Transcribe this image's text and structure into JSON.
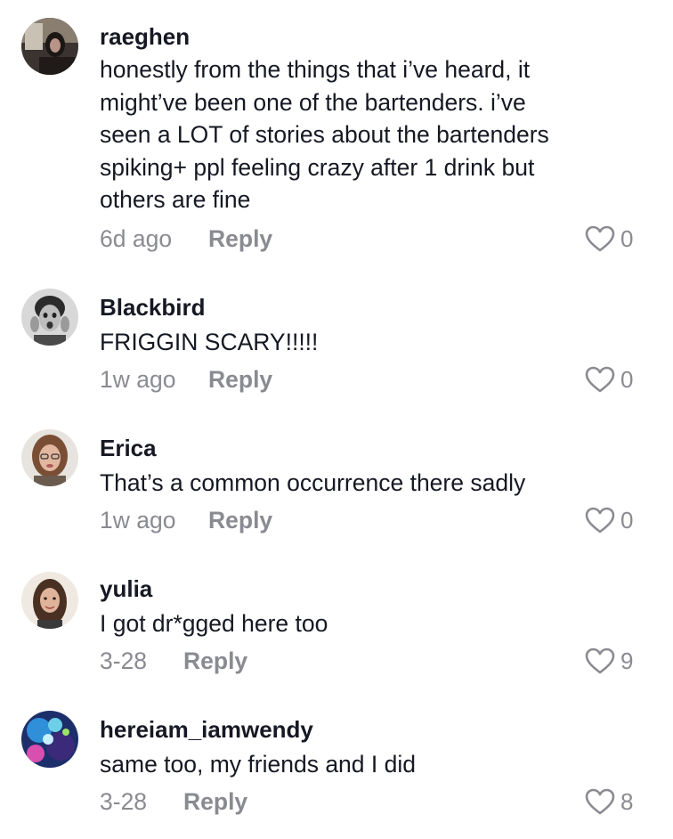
{
  "comments": [
    {
      "username": "raeghen",
      "lines": [
        "honestly from the things that i’ve heard, it",
        "might’ve been one of the bartenders. i’ve",
        "seen a LOT of stories about the bartenders",
        "spiking+ ppl feeling crazy after 1 drink but",
        "others are fine"
      ],
      "time": "6d ago",
      "reply_label": "Reply",
      "likes": "0"
    },
    {
      "username": "Blackbird",
      "lines": [
        "FRIGGIN SCARY!!!!!"
      ],
      "time": "1w ago",
      "reply_label": "Reply",
      "likes": "0"
    },
    {
      "username": "Erica",
      "lines": [
        "That’s a common occurrence there sadly"
      ],
      "time": "1w ago",
      "reply_label": "Reply",
      "likes": "0"
    },
    {
      "username": "yulia",
      "lines": [
        "I got dr*gged here too"
      ],
      "time": "3-28",
      "reply_label": "Reply",
      "likes": "9"
    },
    {
      "username": "hereiam_iamwendy",
      "lines": [
        "same too, my friends and I did"
      ],
      "time": "3-28",
      "reply_label": "Reply",
      "likes": "8"
    }
  ],
  "colors": {
    "text": "#161823",
    "secondary": "#8a8b91"
  },
  "icons": {
    "like": "heart-outline-icon"
  }
}
